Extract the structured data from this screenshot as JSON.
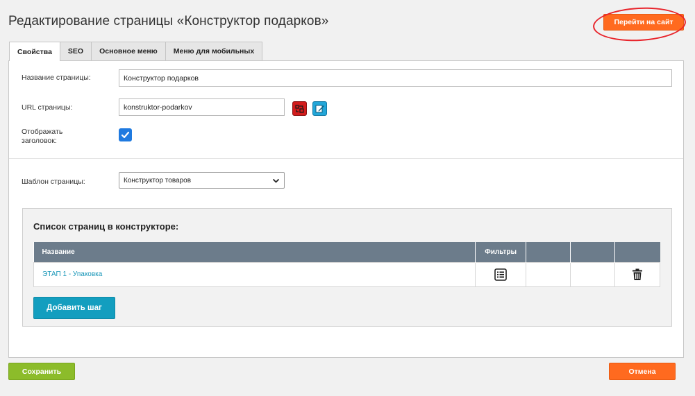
{
  "header": {
    "title": "Редактирование страницы «Конструктор подарков»",
    "goto_site_label": "Перейти на сайт"
  },
  "tabs": [
    {
      "label": "Свойства",
      "active": true
    },
    {
      "label": "SEO",
      "active": false
    },
    {
      "label": "Основное меню",
      "active": false
    },
    {
      "label": "Меню для мобильных",
      "active": false
    }
  ],
  "form": {
    "page_name_label": "Название страницы:",
    "page_name_value": "Конструктор подарков",
    "url_label": "URL страницы:",
    "url_value": "konstruktor-podarkov",
    "show_title_label_line1": "Отображать",
    "show_title_label_line2": "заголовок:",
    "show_title_checked": true,
    "template_label": "Шаблон страницы:",
    "template_value": "Конструктор товаров"
  },
  "constructor": {
    "title": "Список страниц в конструкторе:",
    "columns": [
      "Название",
      "Фильтры",
      "",
      "",
      ""
    ],
    "rows": [
      {
        "name": "ЭТАП 1 - Упаковка"
      }
    ],
    "add_step_label": "Добавить шаг"
  },
  "footer": {
    "save_label": "Сохранить",
    "cancel_label": "Отмена"
  },
  "colors": {
    "accent_orange": "#ff6a1f",
    "save_green": "#8cbc2a",
    "add_teal": "#139ebf",
    "header_gray": "#6c7c8b",
    "highlight_red": "#e8242b"
  }
}
